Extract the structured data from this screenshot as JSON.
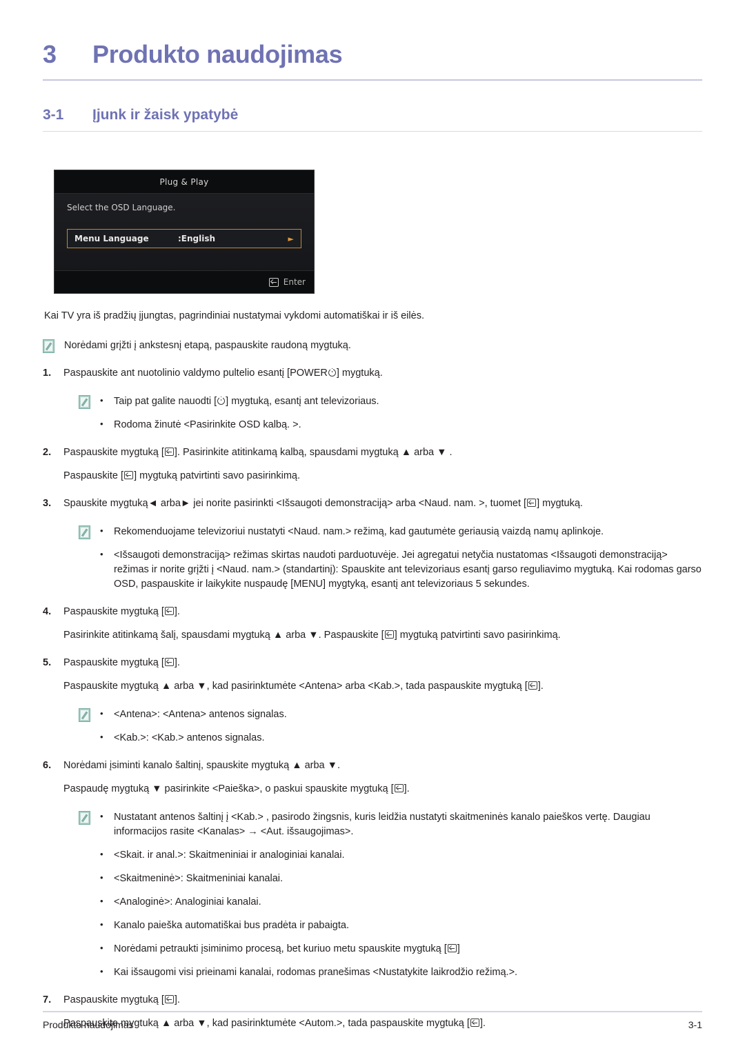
{
  "chapter": {
    "number": "3",
    "title": "Produkto naudojimas"
  },
  "section": {
    "number": "3-1",
    "title": "Įjunk ir žaisk ypatybė"
  },
  "osd": {
    "title": "Plug & Play",
    "prompt": "Select the OSD Language.",
    "row_label": "Menu Language",
    "row_value": ":English",
    "row_arrow": "►",
    "footer_label": "Enter",
    "border_color": "#c08a3c",
    "background_color": "#17181a"
  },
  "intro": "Kai TV yra iš pradžių įjungtas, pagrindiniai nustatymai vykdomi automatiškai ir iš eilės.",
  "intro_note": "Norėdami grįžti į ankstesnį etapą, paspauskite raudoną mygtuką.",
  "steps": [
    {
      "num": "1.",
      "lines": [
        {
          "pre": "Paspauskite ant nuotolinio valdymo pultelio esantį [POWER",
          "glyph": "power-icon",
          "post": "] mygtuką."
        }
      ],
      "notes": [
        {
          "pre": "Taip pat galite nauodti [",
          "glyph": "power-icon",
          "post": "] mygtuką, esantį ant televizoriaus."
        },
        {
          "pre": "Rodoma žinutė <Pasirinkite OSD kalbą. >.",
          "glyph": "",
          "post": ""
        }
      ]
    },
    {
      "num": "2.",
      "lines": [
        {
          "pre": "Paspauskite mygtuką [",
          "glyph": "enter-icon",
          "post": "]. Pasirinkite atitinkamą kalbą, spausdami mygtuką ▲ arba ▼ ."
        },
        {
          "pre": "Paspauskite [",
          "glyph": "enter-icon",
          "post": "] mygtuką patvirtinti savo pasirinkimą."
        }
      ],
      "notes": []
    },
    {
      "num": "3.",
      "lines": [
        {
          "pre": "Spauskite mygtuką◄ arba► jei norite pasirinkti <Išsaugoti demonstraciją> arba <Naud. nam. >, tuomet [",
          "glyph": "enter-icon",
          "post": "] mygtuką."
        }
      ],
      "notes": [
        {
          "pre": "Rekomenduojame televizoriui nustatyti <Naud. nam.> režimą, kad gautumėte geriausią vaizdą namų aplinkoje.",
          "glyph": "",
          "post": ""
        },
        {
          "pre": "<Išsaugoti demonstraciją> režimas skirtas naudoti parduotuvėje. Jei agregatui netyčia nustatomas <Išsaugoti demonstraciją> režimas ir norite grįžti į <Naud. nam.> (standartinį): Spauskite ant televizoriaus esantį garso reguliavimo mygtuką. Kai rodomas garso OSD, paspauskite ir laikykite nuspaudę [MENU] mygtyką, esantį ant televizoriaus 5 sekundes.",
          "glyph": "",
          "post": ""
        }
      ]
    },
    {
      "num": "4.",
      "lines": [
        {
          "pre": "Paspauskite mygtuką [",
          "glyph": "enter-icon",
          "post": "]."
        },
        {
          "pre": "Pasirinkite atitinkamą šalį, spausdami mygtuką ▲ arba ▼. Paspauskite [",
          "glyph": "enter-icon",
          "post": "] mygtuką patvirtinti savo pasirinkimą."
        }
      ],
      "notes": []
    },
    {
      "num": "5.",
      "lines": [
        {
          "pre": "Paspauskite mygtuką [",
          "glyph": "enter-icon",
          "post": "]."
        },
        {
          "pre": "Paspauskite mygtuką ▲ arba ▼, kad pasirinktumėte <Antena> arba <Kab.>, tada paspauskite mygtuką [",
          "glyph": "enter-icon",
          "post": "]."
        }
      ],
      "notes": [
        {
          "pre": "<Antena>: <Antena> antenos signalas.",
          "glyph": "",
          "post": ""
        },
        {
          "pre": "<Kab.>: <Kab.> antenos signalas.",
          "glyph": "",
          "post": ""
        }
      ]
    },
    {
      "num": "6.",
      "lines": [
        {
          "pre": "Norėdami įsiminti kanalo šaltinį, spauskite mygtuką ▲ arba ▼.",
          "glyph": "",
          "post": ""
        },
        {
          "pre": "Paspaudę mygtuką ▼ pasirinkite <Paieška>, o paskui spauskite mygtuką [",
          "glyph": "enter-icon",
          "post": "]."
        }
      ],
      "notes": [
        {
          "pre": "Nustatant antenos šaltinį į <Kab.> , pasirodo žingsnis, kuris leidžia nustatyti skaitmeninės kanalo paieškos vertę. Daugiau informacijos rasite <Kanalas> → <Aut. išsaugojimas>.",
          "glyph": "",
          "post": ""
        },
        {
          "pre": "<Skait. ir anal.>: Skaitmeniniai ir analoginiai kanalai.",
          "glyph": "",
          "post": ""
        },
        {
          "pre": "<Skaitmeninė>: Skaitmeniniai kanalai.",
          "glyph": "",
          "post": ""
        },
        {
          "pre": "<Analoginė>: Analoginiai kanalai.",
          "glyph": "",
          "post": ""
        },
        {
          "pre": "Kanalo paieška automatiškai bus pradėta ir pabaigta.",
          "glyph": "",
          "post": ""
        },
        {
          "pre": "Norėdami petraukti įsiminimo procesą, bet kuriuo metu spauskite mygtuką [",
          "glyph": "enter-icon",
          "post": "]"
        },
        {
          "pre": "Kai išsaugomi visi prieinami kanalai, rodomas pranešimas <Nustatykite laikrodžio režimą.>.",
          "glyph": "",
          "post": ""
        }
      ]
    },
    {
      "num": "7.",
      "lines": [
        {
          "pre": "Paspauskite mygtuką [",
          "glyph": "enter-icon",
          "post": "]."
        },
        {
          "pre": "Paspauskite mygtuką ▲ arba ▼, kad pasirinktumėte <Autom.>, tada paspauskite mygtuką [",
          "glyph": "enter-icon",
          "post": "]."
        }
      ],
      "notes": []
    }
  ],
  "bullet_char": "•",
  "footer": {
    "left": "Produkto naudojimas",
    "right": "3-1"
  },
  "colors": {
    "heading": "#6f72b3",
    "rule": "#c6c6e0",
    "text": "#231f20",
    "note_icon": "#7fb3a6"
  }
}
